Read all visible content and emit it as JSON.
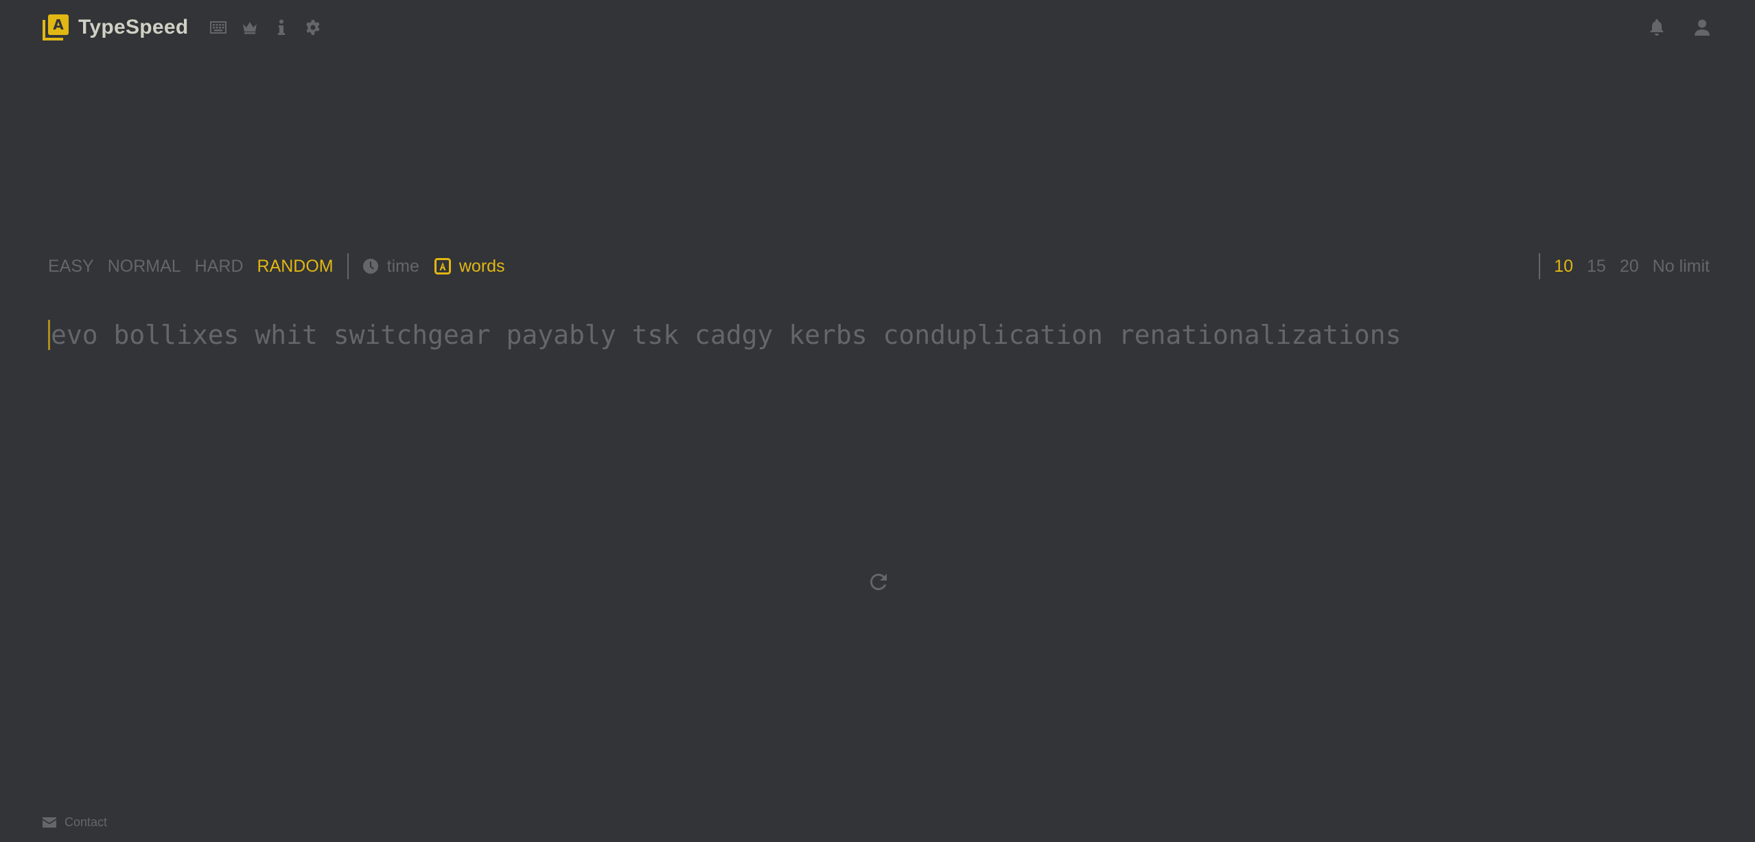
{
  "app": {
    "logo_letter": "A",
    "brand": "TypeSpeed"
  },
  "header": {
    "nav_icons": [
      "keyboard-icon",
      "crown-icon",
      "info-icon",
      "gear-icon"
    ],
    "right_icons": [
      "bell-icon",
      "user-icon"
    ]
  },
  "config": {
    "difficulty": [
      {
        "label": "EASY",
        "active": false
      },
      {
        "label": "NORMAL",
        "active": false
      },
      {
        "label": "HARD",
        "active": false
      },
      {
        "label": "RANDOM",
        "active": true
      }
    ],
    "modes": [
      {
        "label": "time",
        "icon": "clock-icon",
        "active": false
      },
      {
        "label": "words",
        "icon": "letter-a-icon",
        "active": true
      }
    ],
    "word_counts": [
      {
        "label": "10",
        "active": true
      },
      {
        "label": "15",
        "active": false
      },
      {
        "label": "20",
        "active": false
      },
      {
        "label": "No limit",
        "active": false
      }
    ]
  },
  "test": {
    "words": "evo bollixes whit switchgear payably tsk cadgy kerbs conduplication renationalizations"
  },
  "restart": {
    "icon": "restart-icon"
  },
  "footer": {
    "contact_label": "Contact",
    "icon": "envelope-icon"
  },
  "colors": {
    "background": "#323437",
    "accent": "#e2b714",
    "sub": "#646669",
    "text": "#d1d0c5"
  }
}
